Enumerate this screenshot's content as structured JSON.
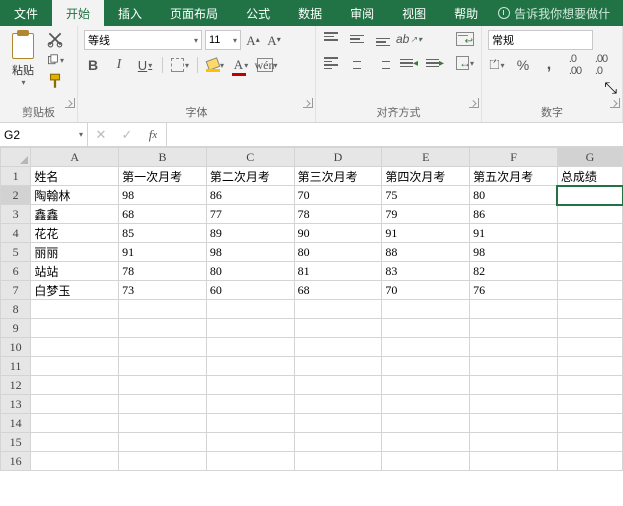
{
  "tabs": {
    "file": "文件",
    "home": "开始",
    "insert": "插入",
    "layout": "页面布局",
    "formulas": "公式",
    "data": "数据",
    "review": "审阅",
    "view": "视图",
    "help": "帮助",
    "tellme": "告诉我你想要做什"
  },
  "ribbon": {
    "clipboard": {
      "label": "剪贴板",
      "paste": "粘贴"
    },
    "font": {
      "label": "字体",
      "name": "等线",
      "size": "11",
      "wen": "wén"
    },
    "alignment": {
      "label": "对齐方式"
    },
    "number": {
      "label": "数字",
      "format": "常规"
    }
  },
  "namebox": "G2",
  "formula": "",
  "columns": [
    "A",
    "B",
    "C",
    "D",
    "E",
    "F",
    "G"
  ],
  "active": {
    "col": 6,
    "row": 2
  },
  "rows": [
    {
      "n": 1,
      "cells": [
        "姓名",
        "第一次月考",
        "第二次月考",
        "第三次月考",
        "第四次月考",
        "第五次月考",
        "总成绩"
      ]
    },
    {
      "n": 2,
      "cells": [
        "陶翰林",
        "98",
        "86",
        "70",
        "75",
        "80",
        ""
      ]
    },
    {
      "n": 3,
      "cells": [
        "鑫鑫",
        "68",
        "77",
        "78",
        "79",
        "86",
        ""
      ]
    },
    {
      "n": 4,
      "cells": [
        "花花",
        "85",
        "89",
        "90",
        "91",
        "91",
        ""
      ]
    },
    {
      "n": 5,
      "cells": [
        "丽丽",
        "91",
        "98",
        "80",
        "88",
        "98",
        ""
      ]
    },
    {
      "n": 6,
      "cells": [
        "站站",
        "78",
        "80",
        "81",
        "83",
        "82",
        ""
      ]
    },
    {
      "n": 7,
      "cells": [
        "白梦玉",
        "73",
        "60",
        "68",
        "70",
        "76",
        ""
      ]
    },
    {
      "n": 8,
      "cells": [
        "",
        "",
        "",
        "",
        "",
        "",
        ""
      ]
    },
    {
      "n": 9,
      "cells": [
        "",
        "",
        "",
        "",
        "",
        "",
        ""
      ]
    },
    {
      "n": 10,
      "cells": [
        "",
        "",
        "",
        "",
        "",
        "",
        ""
      ]
    },
    {
      "n": 11,
      "cells": [
        "",
        "",
        "",
        "",
        "",
        "",
        ""
      ]
    },
    {
      "n": 12,
      "cells": [
        "",
        "",
        "",
        "",
        "",
        "",
        ""
      ]
    },
    {
      "n": 13,
      "cells": [
        "",
        "",
        "",
        "",
        "",
        "",
        ""
      ]
    },
    {
      "n": 14,
      "cells": [
        "",
        "",
        "",
        "",
        "",
        "",
        ""
      ]
    },
    {
      "n": 15,
      "cells": [
        "",
        "",
        "",
        "",
        "",
        "",
        ""
      ]
    },
    {
      "n": 16,
      "cells": [
        "",
        "",
        "",
        "",
        "",
        "",
        ""
      ]
    }
  ]
}
